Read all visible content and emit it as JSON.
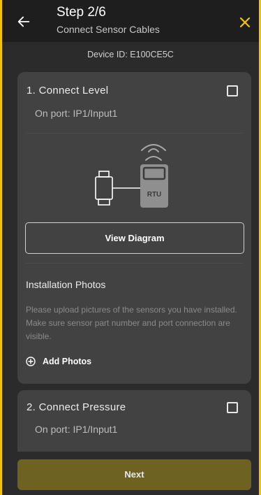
{
  "header": {
    "title": "Step 2/6",
    "subtitle": "Connect Sensor Cables",
    "back_icon": "arrow-left-icon",
    "close_icon": "close-icon",
    "accent_color": "#f4c400"
  },
  "device": {
    "label": "Device ID: E100CE5C"
  },
  "cards": [
    {
      "title": "1. Connect Level",
      "port": "On port: IP1/Input1",
      "checked": false,
      "diagram": {
        "rtu_label": "RTU",
        "icons": [
          "sensor-icon",
          "wifi-icon",
          "rtu-device-icon"
        ]
      },
      "view_button": "View Diagram",
      "photos_title": "Installation Photos",
      "photos_help": "Please upload pictures of the sensors you have installed. Make sure sensor part number and port connection are visible.",
      "add_photos": "Add Photos"
    },
    {
      "title": "2. Connect Pressure",
      "port": "On port: IP1/Input1",
      "checked": false
    }
  ],
  "footer": {
    "next_label": "Next",
    "next_color": "#6e6222"
  }
}
